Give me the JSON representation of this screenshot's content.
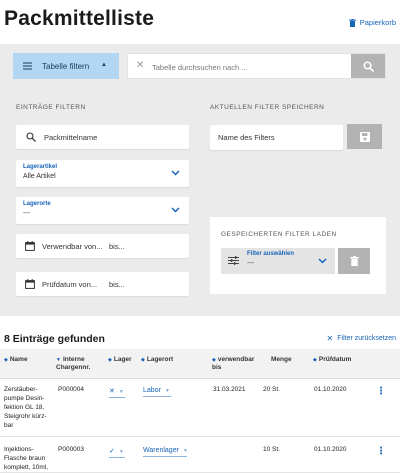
{
  "header": {
    "title": "Packmittelliste",
    "trash_label": "Papierkorb"
  },
  "filter_bar": {
    "toggle_label": "Tabelle filtern",
    "search_placeholder": "Tabelle durchsuchen nach ..."
  },
  "filter_entries": {
    "heading": "EINTRÄGE FILTERN",
    "name_placeholder": "Packmittelname",
    "lagerartikel": {
      "label": "Lagerartikel",
      "value": "Alle Artikel"
    },
    "lagerorte": {
      "label": "Lagerorte",
      "value": "---"
    },
    "verwendbar": {
      "from": "Verwendbar von...",
      "to": "bis..."
    },
    "pruefdatum": {
      "from": "Prüfdatum von...",
      "to": "bis..."
    }
  },
  "save_filter": {
    "heading": "AKTUELLEN FILTER SPEICHERN",
    "name_placeholder": "Name des Filters"
  },
  "load_filter": {
    "heading": "GESPEICHERTEN FILTER LADEN",
    "select_label": "Filter auswählen",
    "select_value": "---"
  },
  "results": {
    "count_text": "8 Einträge gefunden",
    "reset_label": "Filter zurücksetzen"
  },
  "table": {
    "columns": {
      "name": "Name",
      "interne": "Interne Chargennr.",
      "lager": "Lager",
      "lagerort": "Lagerort",
      "verwendbar": "verwendbar bis",
      "menge": "Menge",
      "pruefdatum": "Prüfdatum"
    },
    "rows": [
      {
        "name": "Zerstäuber-pumpe Desin-fektion GL 18, Steigrohr kürz-bar",
        "interne": "P000004",
        "lager": "✕",
        "lagerort": "Labor",
        "verwendbar": "31.03.2021",
        "menge": "20 St.",
        "pruefdatum": "01.10.2020"
      },
      {
        "name": "Injektions-Flasche braun komplett, 10ml,",
        "interne": "P000003",
        "lager": "✓",
        "lagerort": "Warenlager",
        "verwendbar": "",
        "menge": "10 St.",
        "pruefdatum": "01.10.2020"
      }
    ]
  },
  "colors": {
    "accent": "#1764b8",
    "panel_bg": "#ebebeb",
    "toggle_bg": "#b3d7f2",
    "button_grey": "#b3b3b3"
  }
}
